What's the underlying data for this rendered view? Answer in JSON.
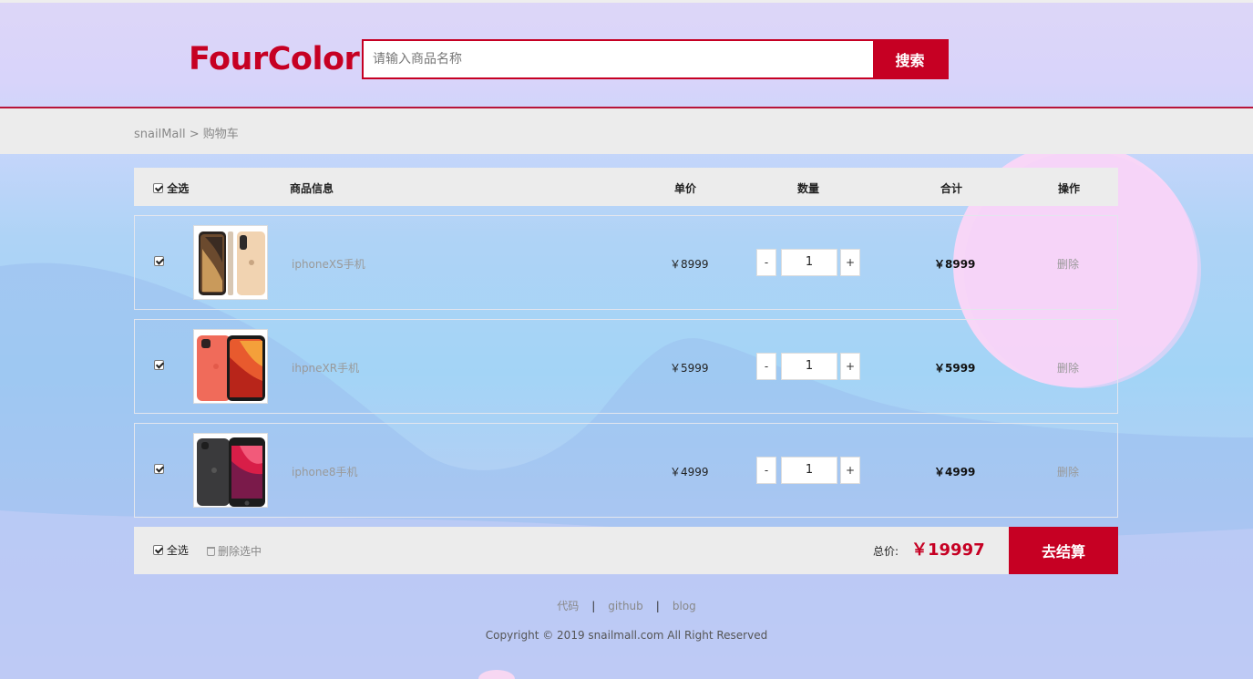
{
  "header": {
    "logo": "FourColor",
    "search_placeholder": "请输入商品名称",
    "search_button": "搜索"
  },
  "breadcrumb": {
    "home": "snailMall",
    "separator": ">",
    "current": "购物车"
  },
  "cart": {
    "columns": {
      "select_all": "全选",
      "info": "商品信息",
      "price": "单价",
      "quantity": "数量",
      "subtotal": "合计",
      "action": "操作"
    },
    "items": [
      {
        "name": "iphoneXS手机",
        "price": "￥8999",
        "quantity": "1",
        "subtotal": "￥8999",
        "delete": "删除",
        "checked": true
      },
      {
        "name": "ihpneXR手机",
        "price": "￥5999",
        "quantity": "1",
        "subtotal": "￥5999",
        "delete": "删除",
        "checked": true
      },
      {
        "name": "iphone8手机",
        "price": "￥4999",
        "quantity": "1",
        "subtotal": "￥4999",
        "delete": "删除",
        "checked": true
      }
    ],
    "qty_minus": "-",
    "qty_plus": "+",
    "footer": {
      "select_all": "全选",
      "delete_selected": "删除选中",
      "total_label": "总价:",
      "total_value": "￥19997",
      "checkout": "去结算"
    }
  },
  "footer": {
    "links": [
      "代码",
      "github",
      "blog"
    ],
    "separator": "|",
    "copyright": "Copyright © 2019 snailmall.com All Right Reserved"
  },
  "colors": {
    "brand": "#c60023",
    "bar_bg": "#ececec"
  }
}
